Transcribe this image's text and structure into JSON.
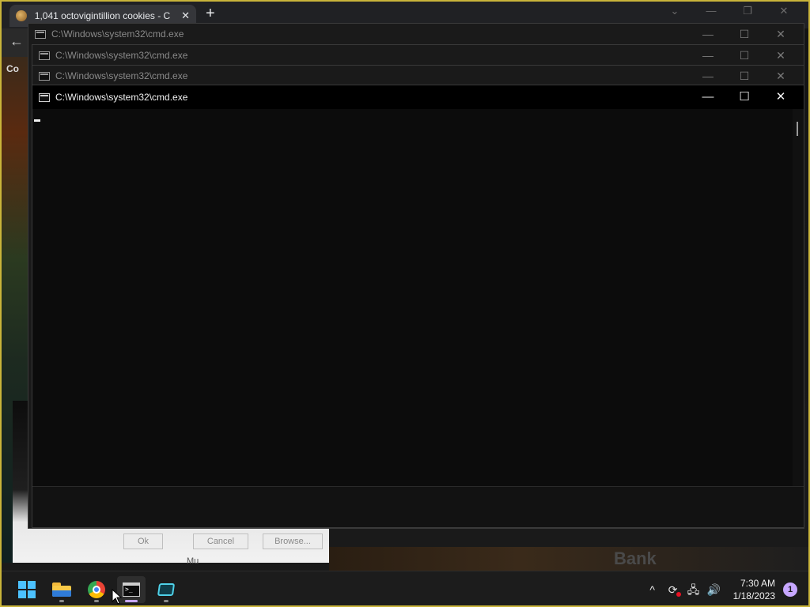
{
  "browser": {
    "tab_title": "1,041 octovigintillion cookies - C",
    "tab_close": "✕",
    "new_tab": "+",
    "controls": [
      "⌄",
      "—",
      "❐",
      "✕"
    ],
    "back": "←",
    "strip_label": "Co"
  },
  "dialog_remnant": {
    "ok_label": "Ok",
    "cancel_label": "Cancel",
    "browse_label": "Browse..."
  },
  "game": {
    "bank_label": "Bank",
    "mu_label": "Mu"
  },
  "cmd_windows": [
    {
      "title": "C:\\Windows\\system32\\cmd.exe",
      "min": "—",
      "max": "☐",
      "close": "✕"
    },
    {
      "title": "C:\\Windows\\system32\\cmd.exe",
      "min": "—",
      "max": "☐",
      "close": "✕"
    },
    {
      "title": "C:\\Windows\\system32\\cmd.exe",
      "min": "—",
      "max": "☐",
      "close": "✕"
    },
    {
      "title": "C:\\Windows\\system32\\cmd.exe",
      "min": "—",
      "max": "☐",
      "close": "✕"
    }
  ],
  "taskbar": {
    "apps": [
      "start",
      "file-explorer",
      "chrome",
      "cmd",
      "app"
    ],
    "tray": {
      "chevron": "^",
      "time": "7:30 AM",
      "date": "1/18/2023",
      "notification_count": "1"
    }
  },
  "colors": {
    "accent": "#c7a7ff",
    "console_bg": "#0c0c0c",
    "frame": "#c9b43a"
  }
}
